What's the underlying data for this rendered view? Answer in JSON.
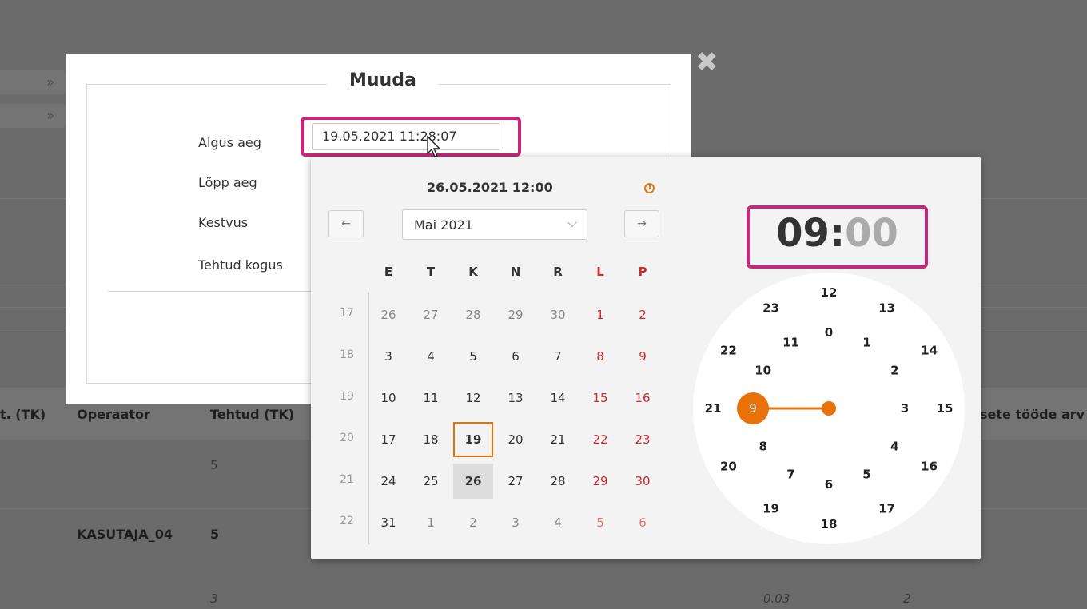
{
  "background": {
    "columns": [
      "t. (TK)",
      "Operaator",
      "Tehtud (TK)",
      "sete tööde arv"
    ],
    "rows": [
      {
        "tehtud": "5"
      },
      {
        "operaator": "KASUTAJA_04",
        "tehtud": "5"
      },
      {
        "tehtud": "3",
        "col_a": "0.03",
        "col_b": "2"
      }
    ],
    "expand_glyph": "»"
  },
  "modal": {
    "title": "Muuda",
    "close_glyph": "✖",
    "labels": {
      "start": "Algus aeg",
      "end": "Lõpp aeg",
      "duration": "Kestvus",
      "done_qty": "Tehtud kogus"
    },
    "start_value": "19.05.2021 11:28:07"
  },
  "picker": {
    "title": "26.05.2021 12:00",
    "prev_glyph": "←",
    "next_glyph": "→",
    "month_label": "Mai 2021",
    "month_chevron": "⌵",
    "weekdays": [
      "E",
      "T",
      "K",
      "N",
      "R",
      "L",
      "P"
    ],
    "weeks": [
      {
        "num": "17",
        "days": [
          "26",
          "27",
          "28",
          "29",
          "30",
          "1",
          "2"
        ],
        "other": [
          0,
          1,
          2,
          3,
          4
        ]
      },
      {
        "num": "18",
        "days": [
          "3",
          "4",
          "5",
          "6",
          "7",
          "8",
          "9"
        ],
        "other": []
      },
      {
        "num": "19",
        "days": [
          "10",
          "11",
          "12",
          "13",
          "14",
          "15",
          "16"
        ],
        "other": []
      },
      {
        "num": "20",
        "days": [
          "17",
          "18",
          "19",
          "20",
          "21",
          "22",
          "23"
        ],
        "other": [],
        "selected": 2
      },
      {
        "num": "21",
        "days": [
          "24",
          "25",
          "26",
          "27",
          "28",
          "29",
          "30"
        ],
        "other": [],
        "today": 2
      },
      {
        "num": "22",
        "days": [
          "31",
          "1",
          "2",
          "3",
          "4",
          "5",
          "6"
        ],
        "other": [
          1,
          2,
          3,
          4,
          5,
          6
        ]
      }
    ],
    "time_hours": "09",
    "time_sep": ":",
    "time_minutes": "00",
    "selected_hour": "9",
    "outer_hours": [
      "12",
      "13",
      "14",
      "15",
      "16",
      "17",
      "18",
      "19",
      "20",
      "21",
      "22",
      "23"
    ],
    "inner_hours": [
      "0",
      "1",
      "2",
      "3",
      "4",
      "5",
      "6",
      "7",
      "8",
      "9",
      "10",
      "11"
    ],
    "accent_color": "#e8710a",
    "highlight_color": "#c8277d"
  }
}
